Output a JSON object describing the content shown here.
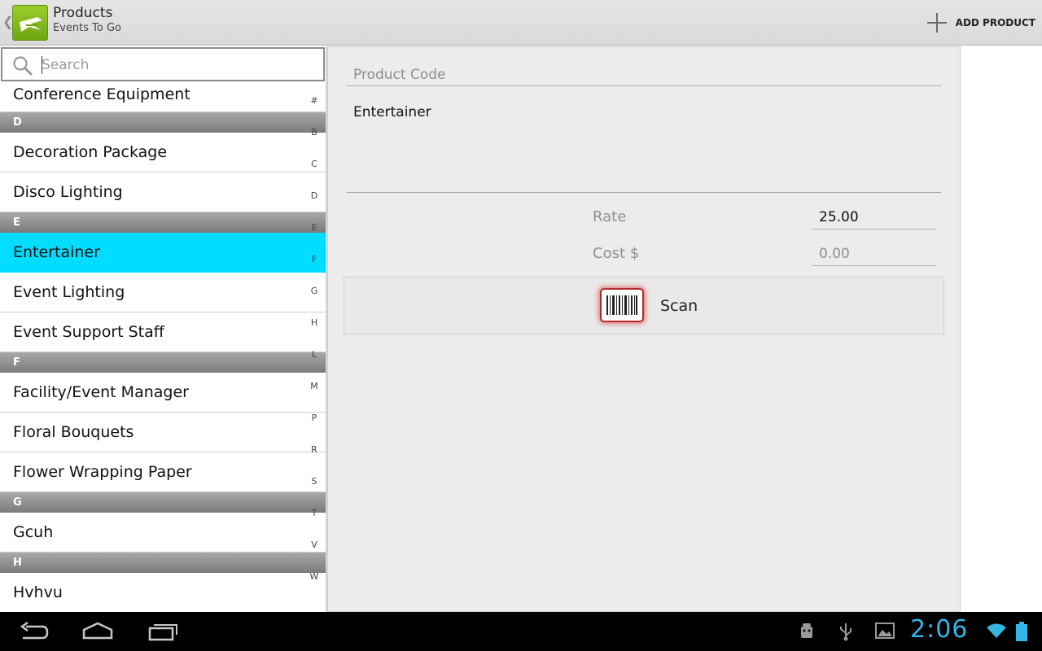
{
  "action_bar": {
    "title": "Products",
    "subtitle": "Events To Go",
    "add_label": "ADD PRODUCT",
    "app_icon": "events-app-icon"
  },
  "search": {
    "placeholder": "Search",
    "value": ""
  },
  "list": {
    "rows": [
      {
        "type": "item",
        "label": "Conference Equipment"
      },
      {
        "type": "header",
        "label": "D"
      },
      {
        "type": "item",
        "label": "Decoration Package"
      },
      {
        "type": "item",
        "label": "Disco Lighting"
      },
      {
        "type": "header",
        "label": "E"
      },
      {
        "type": "item",
        "label": "Entertainer",
        "selected": true
      },
      {
        "type": "item",
        "label": "Event Lighting"
      },
      {
        "type": "item",
        "label": "Event Support Staff"
      },
      {
        "type": "header",
        "label": "F"
      },
      {
        "type": "item",
        "label": "Facility/Event Manager"
      },
      {
        "type": "item",
        "label": "Floral Bouquets"
      },
      {
        "type": "item",
        "label": "Flower Wrapping Paper"
      },
      {
        "type": "header",
        "label": "G"
      },
      {
        "type": "item",
        "label": "Gcuh"
      },
      {
        "type": "header",
        "label": "H"
      },
      {
        "type": "item",
        "label": "Hvhvu"
      }
    ],
    "index_letters": [
      "#",
      "B",
      "C",
      "D",
      "E",
      "F",
      "G",
      "H",
      "L",
      "M",
      "P",
      "R",
      "S",
      "T",
      "V",
      "W"
    ]
  },
  "detail": {
    "code_placeholder": "Product Code",
    "name_value": "Entertainer",
    "rate_label": "Rate",
    "rate_value": "25.00",
    "cost_label": "Cost $",
    "cost_placeholder": "0.00",
    "scan_label": "Scan"
  },
  "system_bar": {
    "clock": "2:06",
    "accent_color": "#33b5e5"
  },
  "colors": {
    "selected_row": "#00ddff",
    "app_icon_green": "#8cc021"
  }
}
